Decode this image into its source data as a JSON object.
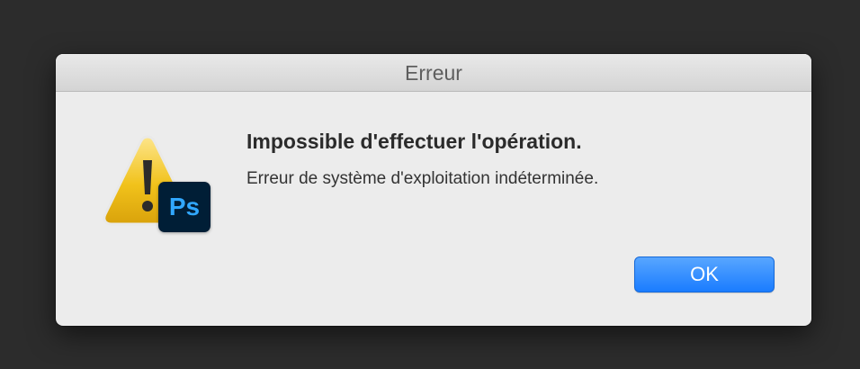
{
  "dialog": {
    "title": "Erreur",
    "heading": "Impossible d'effectuer l'opération.",
    "message": "Erreur de système d'exploitation indéterminée.",
    "ok_label": "OK",
    "icon": "warning-triangle-icon",
    "app_badge": {
      "label": "Ps",
      "icon": "photoshop-app-icon",
      "background": "#001e36",
      "text_color": "#31a8ff"
    },
    "accent_color": "#1a7cff"
  }
}
